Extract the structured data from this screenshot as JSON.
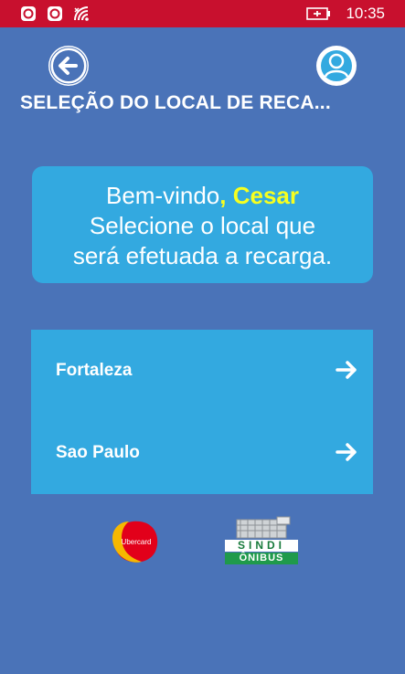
{
  "status_bar": {
    "time": "10:35",
    "icons": [
      "app-notification-icon",
      "app-notification-icon",
      "wifi-icon",
      "battery-charging-icon"
    ]
  },
  "header": {
    "title": "SELEÇÃO DO LOCAL DE RECA...",
    "back_icon": "arrow-left-icon",
    "profile_icon": "user-icon"
  },
  "welcome": {
    "greeting": "Bem-vindo",
    "name": ", Cesar",
    "line2": "Selecione o local que",
    "line3": "será efetuada a recarga."
  },
  "locations": [
    {
      "label": "Fortaleza",
      "icon": "arrow-right-icon"
    },
    {
      "label": "Sao Paulo",
      "icon": "arrow-right-icon"
    }
  ],
  "logos": {
    "ubercard": "Ubercard",
    "sindi": "SINDI",
    "onibus": "ÔNIBUS"
  },
  "colors": {
    "status_bar": "#c8102e",
    "background": "#4a73b8",
    "card": "#33a9e0",
    "highlight": "#f7ff1f"
  }
}
